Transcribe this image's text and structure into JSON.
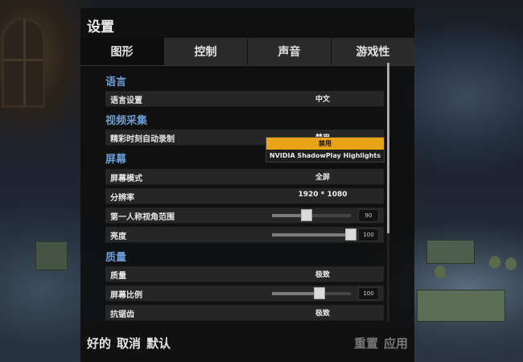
{
  "panel": {
    "title": "设置"
  },
  "tabs": [
    {
      "label": "图形",
      "active": true
    },
    {
      "label": "控制",
      "active": false
    },
    {
      "label": "声音",
      "active": false
    },
    {
      "label": "游戏性",
      "active": false
    }
  ],
  "sections": {
    "language": {
      "title": "语言",
      "rows": [
        {
          "label": "语言设置",
          "value": "中文"
        }
      ]
    },
    "capture": {
      "title": "视频采集",
      "rows": [
        {
          "label": "精彩时刻自动录制",
          "value": "禁用"
        }
      ]
    },
    "screen": {
      "title": "屏幕",
      "rows": [
        {
          "label": "屏幕模式",
          "value": "全屏"
        },
        {
          "label": "分辨率",
          "value": "1920 * 1080"
        },
        {
          "label": "第一人称视角范围",
          "slider": 90,
          "slider_fraction": 0.44
        },
        {
          "label": "亮度",
          "slider": 100,
          "slider_fraction": 1.0
        }
      ]
    },
    "quality": {
      "title": "质量",
      "rows": [
        {
          "label": "质量",
          "value": "极致"
        },
        {
          "label": "屏幕比例",
          "slider": 100,
          "slider_fraction": 0.6
        },
        {
          "label": "抗锯齿",
          "value": "极致"
        }
      ]
    }
  },
  "dropdown": {
    "options": [
      "禁用",
      "NVIDIA ShadowPlay Highlights"
    ],
    "selected_index": 0
  },
  "footer": {
    "ok": "好的",
    "cancel": "取消",
    "default": "默认",
    "reset": "重置",
    "apply": "应用"
  },
  "colors": {
    "accent": "#e8a316",
    "section_title": "#6b9cd2"
  }
}
